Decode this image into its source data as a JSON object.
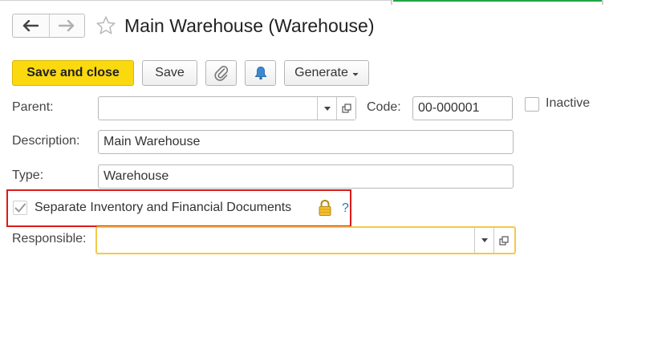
{
  "colors": {
    "accent": "#fbd90f",
    "highlight_border": "#dd1a1a",
    "focus_border": "#f4c84a",
    "tab_indicator": "#22a547"
  },
  "window": {
    "title": "Main Warehouse (Warehouse)"
  },
  "nav": {
    "back_icon": "arrow-left-icon",
    "forward_icon": "arrow-right-icon",
    "favorite_icon": "star-icon"
  },
  "toolbar": {
    "save_close_label": "Save and close",
    "save_label": "Save",
    "attach_icon": "paperclip-icon",
    "reminder_icon": "bell-icon",
    "generate_label": "Generate"
  },
  "form": {
    "parent": {
      "label": "Parent:",
      "value": ""
    },
    "code": {
      "label": "Code:",
      "value": "00-000001"
    },
    "inactive": {
      "label": "Inactive",
      "checked": false
    },
    "description": {
      "label": "Description:",
      "value": "Main Warehouse"
    },
    "type": {
      "label": "Type:",
      "value": "Warehouse"
    },
    "separate_docs": {
      "label": "Separate Inventory and Financial Documents",
      "checked": true,
      "locked": true,
      "help": "?"
    },
    "responsible": {
      "label": "Responsible:",
      "value": ""
    }
  }
}
